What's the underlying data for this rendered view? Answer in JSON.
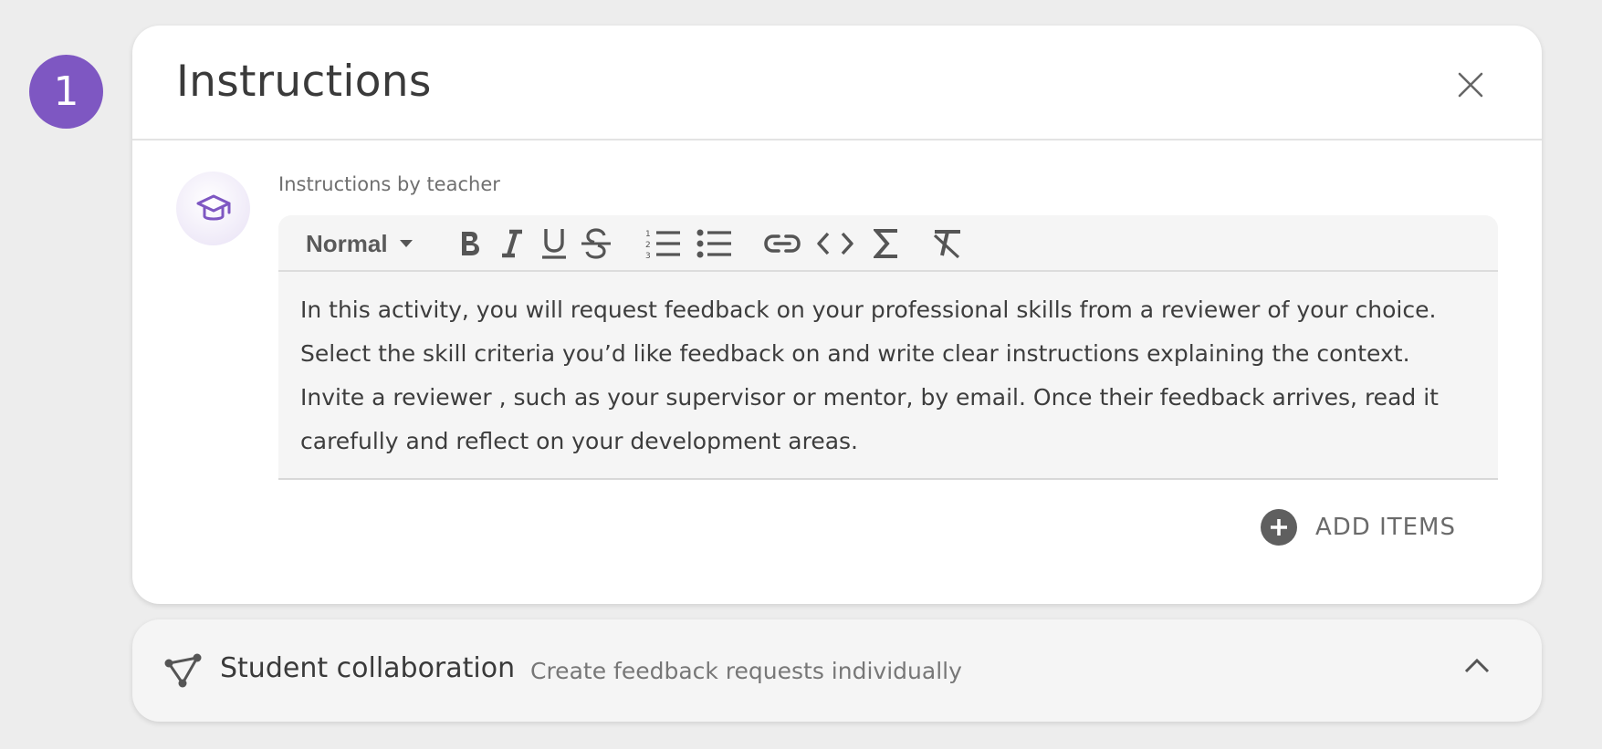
{
  "step": {
    "number": "1",
    "color": "#7e57c2"
  },
  "card": {
    "title": "Instructions",
    "close_icon": "close-icon",
    "instructions_label": "Instructions by teacher",
    "avatar_icon": "graduation-cap-icon"
  },
  "editor": {
    "format_value": "Normal",
    "toolbar": [
      "bold-icon",
      "italic-icon",
      "underline-icon",
      "strikethrough-icon",
      "ordered-list-icon",
      "bullet-list-icon",
      "link-icon",
      "code-icon",
      "formula-icon",
      "clear-format-icon"
    ],
    "lines": [
      "In this activity, you will request feedback on your professional skills from a reviewer of your choice.",
      "Select the skill criteria you’d like feedback on and write clear instructions explaining the context.",
      "Invite a reviewer , such as your supervisor or mentor, by email. Once their feedback arrives, read it",
      "carefully and reflect on your development areas."
    ]
  },
  "add_items": {
    "label": "ADD ITEMS",
    "icon": "plus-circle-icon"
  },
  "collaboration": {
    "title": "Student collaboration",
    "subtitle": "Create feedback requests individually",
    "icon": "share-nodes-icon",
    "chevron": "chevron-up-icon"
  }
}
